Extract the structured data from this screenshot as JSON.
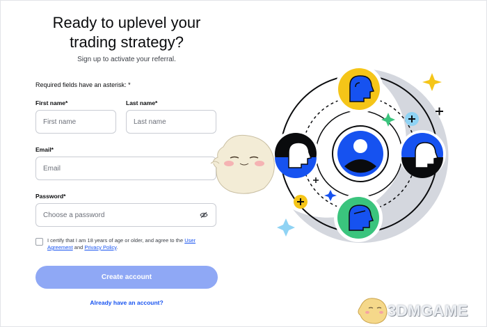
{
  "headline": {
    "line1": "Ready to uplevel your",
    "line2": "trading strategy?"
  },
  "subhead": "Sign up to activate your referral.",
  "required_note": "Required fields have an asterisk: *",
  "form": {
    "first_name": {
      "label": "First name*",
      "placeholder": "First name",
      "value": ""
    },
    "last_name": {
      "label": "Last name*",
      "placeholder": "Last name",
      "value": ""
    },
    "email": {
      "label": "Email*",
      "placeholder": "Email",
      "value": ""
    },
    "password": {
      "label": "Password*",
      "placeholder": "Choose a password",
      "value": ""
    }
  },
  "certify": {
    "text_before": "I certify that I am 18 years of age or older, and agree to the ",
    "link1": "User Agreement",
    "text_middle": " and ",
    "link2": "Privacy Policy",
    "text_after": ".",
    "checked": false
  },
  "create_button": "Create account",
  "signin_link": "Already have an account?",
  "watermark": "3DMGAME",
  "icons": [
    "eye-slash-icon",
    "plus-icon",
    "sparkle-icon",
    "avatar-icon"
  ],
  "colors": {
    "accent": "#1652f0",
    "button_disabled": "#8fa8f5",
    "yellow": "#f5c518",
    "green": "#3ac47d",
    "dark": "#0a0b0d",
    "ring_gray": "#d4d7de"
  }
}
